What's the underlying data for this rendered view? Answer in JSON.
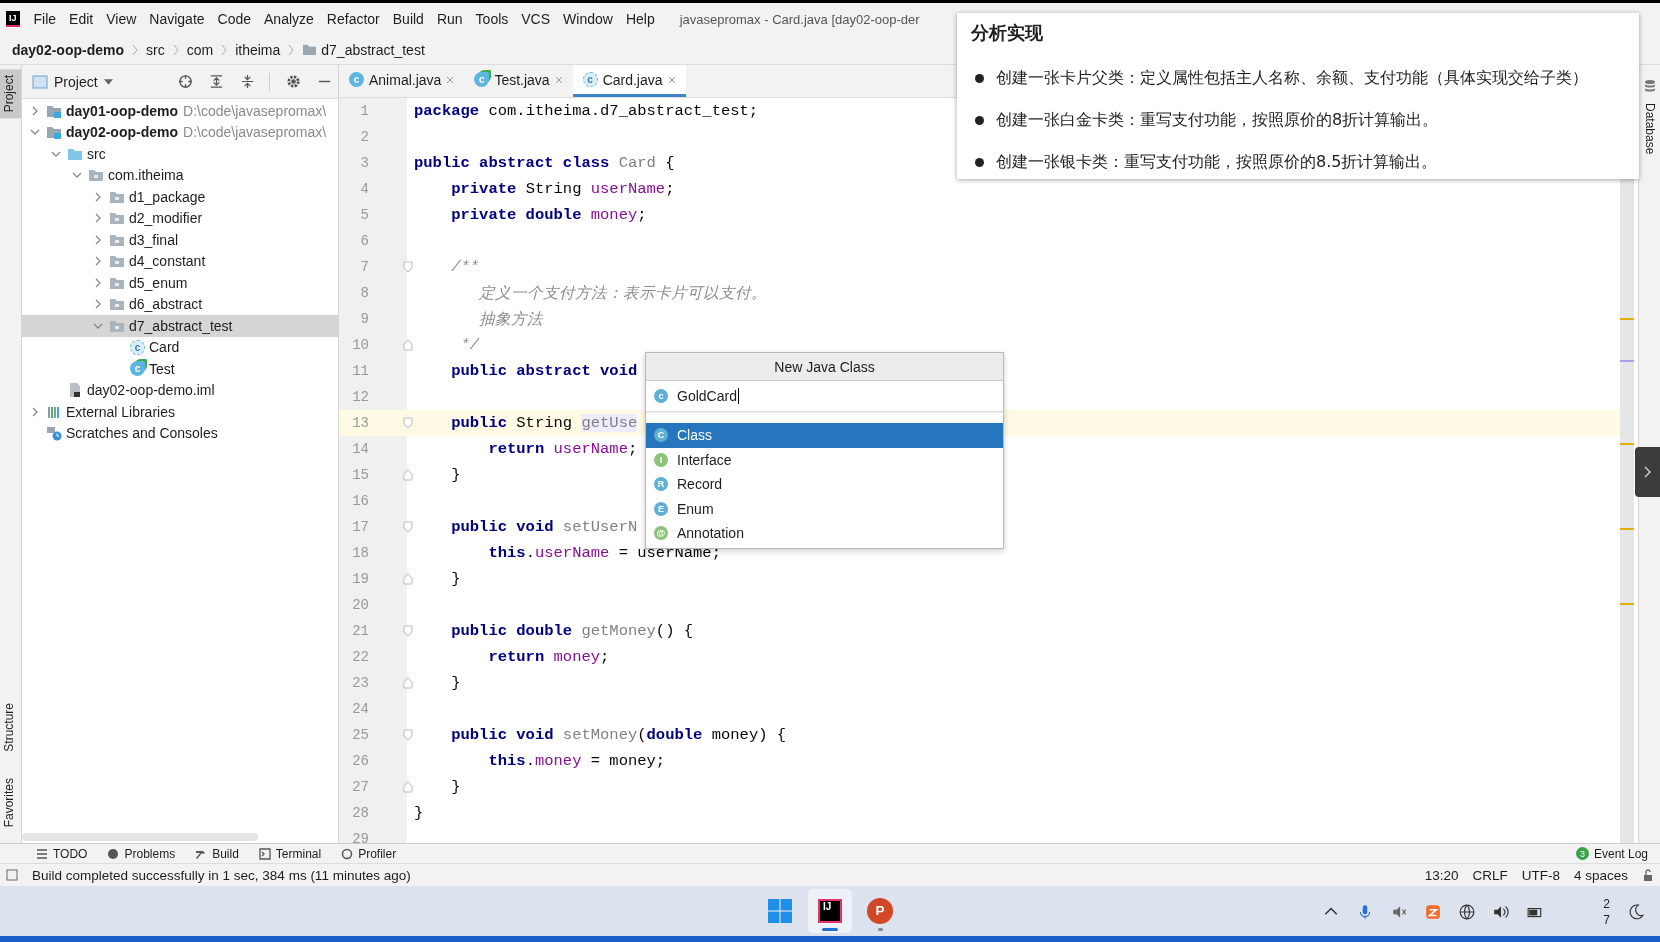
{
  "app_logo": "IJ",
  "menu": [
    "File",
    "Edit",
    "View",
    "Navigate",
    "Code",
    "Analyze",
    "Refactor",
    "Build",
    "Run",
    "Tools",
    "VCS",
    "Window",
    "Help"
  ],
  "window_title": "javasepromax - Card.java [day02-oop-der",
  "breadcrumbs": [
    {
      "label": "day02-oop-demo",
      "kind": "module"
    },
    {
      "label": "src",
      "kind": "dir"
    },
    {
      "label": "com",
      "kind": "dir"
    },
    {
      "label": "itheima",
      "kind": "dir"
    },
    {
      "label": "d7_abstract_test",
      "kind": "package"
    }
  ],
  "left_stripe": {
    "top": [
      {
        "label": "Project",
        "selected": true
      }
    ],
    "bottom": [
      {
        "label": "Structure",
        "selected": false
      },
      {
        "label": "Favorites",
        "selected": false
      }
    ]
  },
  "right_stripe": [
    {
      "label": "Database"
    }
  ],
  "project_panel": {
    "title": "Project",
    "tree": [
      {
        "label": "day01-oop-demo",
        "note": "D:\\code\\javasepromax\\",
        "kind": "module",
        "expanded": false,
        "selected": false
      },
      {
        "label": "day02-oop-demo",
        "note": "D:\\code\\javasepromax\\",
        "kind": "module",
        "expanded": true,
        "selected": false,
        "children": [
          {
            "label": "src",
            "kind": "source",
            "expanded": true,
            "selected": false,
            "children": [
              {
                "label": "com.itheima",
                "kind": "package",
                "expanded": true,
                "selected": false,
                "children": [
                  {
                    "label": "d1_package",
                    "kind": "package",
                    "expanded": false,
                    "selected": false
                  },
                  {
                    "label": "d2_modifier",
                    "kind": "package",
                    "expanded": false,
                    "selected": false
                  },
                  {
                    "label": "d3_final",
                    "kind": "package",
                    "expanded": false,
                    "selected": false
                  },
                  {
                    "label": "d4_constant",
                    "kind": "package",
                    "expanded": false,
                    "selected": false
                  },
                  {
                    "label": "d5_enum",
                    "kind": "package",
                    "expanded": false,
                    "selected": false
                  },
                  {
                    "label": "d6_abstract",
                    "kind": "package",
                    "expanded": false,
                    "selected": false
                  },
                  {
                    "label": "d7_abstract_test",
                    "kind": "package",
                    "expanded": true,
                    "selected": true,
                    "children": [
                      {
                        "label": "Card",
                        "kind": "abstract-class",
                        "icon_text": "c",
                        "selected": false
                      },
                      {
                        "label": "Test",
                        "kind": "runnable-class",
                        "icon_text": "c",
                        "selected": false
                      }
                    ]
                  }
                ]
              }
            ]
          },
          {
            "label": "day02-oop-demo.iml",
            "kind": "iml",
            "selected": false
          }
        ]
      },
      {
        "label": "External Libraries",
        "kind": "libraries",
        "expanded": false,
        "selected": false
      },
      {
        "label": "Scratches and Consoles",
        "kind": "scratches",
        "selected": false
      }
    ]
  },
  "tabs": [
    {
      "label": "Animal.java",
      "kind": "class",
      "icon_text": "c",
      "selected": false
    },
    {
      "label": "Test.java",
      "kind": "runnable",
      "icon_text": "c",
      "selected": false
    },
    {
      "label": "Card.java",
      "kind": "abstract",
      "icon_text": "c",
      "selected": true
    }
  ],
  "code": [
    {
      "n": "1",
      "kind": "plain",
      "caret": false,
      "tokens": [
        {
          "kind": "kw",
          "text": "package"
        },
        {
          "kind": "plain",
          "text": " com.itheima.d7_abstract_test;"
        }
      ]
    },
    {
      "n": "2",
      "kind": "plain",
      "caret": false
    },
    {
      "n": "3",
      "kind": "plain",
      "caret": false,
      "tokens": [
        {
          "kind": "kw",
          "text": "public abstract class "
        },
        {
          "kind": "unused",
          "text": "Card"
        },
        {
          "kind": "plain",
          "text": " {"
        }
      ]
    },
    {
      "n": "4",
      "kind": "plain",
      "caret": false,
      "tokens": [
        {
          "kind": "kw",
          "text": "    private"
        },
        {
          "kind": "plain",
          "text": " String "
        },
        {
          "kind": "field",
          "text": "userName"
        },
        {
          "kind": "plain",
          "text": ";"
        }
      ]
    },
    {
      "n": "5",
      "kind": "plain",
      "caret": false,
      "tokens": [
        {
          "kind": "kw",
          "text": "    private double "
        },
        {
          "kind": "field",
          "text": "money"
        },
        {
          "kind": "plain",
          "text": ";"
        }
      ]
    },
    {
      "n": "6",
      "kind": "plain",
      "caret": false
    },
    {
      "n": "7",
      "kind": "fold-start",
      "caret": false,
      "tokens": [
        {
          "kind": "comment",
          "text": "    /**"
        }
      ]
    },
    {
      "n": "8",
      "kind": "plain",
      "caret": false,
      "tokens": [
        {
          "kind": "comment",
          "text": "       定义一个支付方法：表示卡片可以支付。"
        }
      ]
    },
    {
      "n": "9",
      "kind": "plain",
      "caret": false,
      "tokens": [
        {
          "kind": "comment",
          "text": "       抽象方法"
        }
      ]
    },
    {
      "n": "10",
      "kind": "fold-end",
      "caret": false,
      "tokens": [
        {
          "kind": "comment",
          "text": "     */"
        }
      ]
    },
    {
      "n": "11",
      "kind": "plain",
      "caret": false,
      "tokens": [
        {
          "kind": "kw",
          "text": "    public abstract void"
        }
      ]
    },
    {
      "n": "12",
      "kind": "plain",
      "caret": false
    },
    {
      "n": "13",
      "kind": "fold-start",
      "caret": true,
      "tokens": [
        {
          "kind": "kw",
          "text": "    public"
        },
        {
          "kind": "plain",
          "text": " String "
        },
        {
          "kind": "usage",
          "text": "getUse"
        }
      ]
    },
    {
      "n": "14",
      "kind": "plain",
      "caret": false,
      "tokens": [
        {
          "kind": "kw",
          "text": "        return "
        },
        {
          "kind": "field",
          "text": "userName"
        },
        {
          "kind": "plain",
          "text": ";"
        }
      ]
    },
    {
      "n": "15",
      "kind": "fold-end",
      "caret": false,
      "tokens": [
        {
          "kind": "plain",
          "text": "    }"
        }
      ]
    },
    {
      "n": "16",
      "kind": "plain",
      "caret": false
    },
    {
      "n": "17",
      "kind": "fold-start",
      "caret": false,
      "tokens": [
        {
          "kind": "kw",
          "text": "    public void "
        },
        {
          "kind": "unused",
          "text": "setUserN"
        }
      ]
    },
    {
      "n": "18",
      "kind": "plain",
      "caret": false,
      "tokens": [
        {
          "kind": "kw",
          "text": "        this"
        },
        {
          "kind": "plain",
          "text": "."
        },
        {
          "kind": "field",
          "text": "userName"
        },
        {
          "kind": "plain",
          "text": " = userName;"
        }
      ]
    },
    {
      "n": "19",
      "kind": "fold-end",
      "caret": false,
      "tokens": [
        {
          "kind": "plain",
          "text": "    }"
        }
      ]
    },
    {
      "n": "20",
      "kind": "plain",
      "caret": false
    },
    {
      "n": "21",
      "kind": "fold-start",
      "caret": false,
      "tokens": [
        {
          "kind": "kw",
          "text": "    public double "
        },
        {
          "kind": "unused",
          "text": "getMoney"
        },
        {
          "kind": "plain",
          "text": "() {"
        }
      ]
    },
    {
      "n": "22",
      "kind": "plain",
      "caret": false,
      "tokens": [
        {
          "kind": "kw",
          "text": "        return "
        },
        {
          "kind": "field",
          "text": "money"
        },
        {
          "kind": "plain",
          "text": ";"
        }
      ]
    },
    {
      "n": "23",
      "kind": "fold-end",
      "caret": false,
      "tokens": [
        {
          "kind": "plain",
          "text": "    }"
        }
      ]
    },
    {
      "n": "24",
      "kind": "plain",
      "caret": false
    },
    {
      "n": "25",
      "kind": "fold-start",
      "caret": false,
      "tokens": [
        {
          "kind": "kw",
          "text": "    public void "
        },
        {
          "kind": "unused",
          "text": "setMoney"
        },
        {
          "kind": "plain",
          "text": "("
        },
        {
          "kind": "kw",
          "text": "double"
        },
        {
          "kind": "plain",
          "text": " money) {"
        }
      ]
    },
    {
      "n": "26",
      "kind": "plain",
      "caret": false,
      "tokens": [
        {
          "kind": "kw",
          "text": "        this"
        },
        {
          "kind": "plain",
          "text": "."
        },
        {
          "kind": "field",
          "text": "money"
        },
        {
          "kind": "plain",
          "text": " = money;"
        }
      ]
    },
    {
      "n": "27",
      "kind": "fold-end",
      "caret": false,
      "tokens": [
        {
          "kind": "plain",
          "text": "    }"
        }
      ]
    },
    {
      "n": "28",
      "kind": "plain",
      "caret": false,
      "tokens": [
        {
          "kind": "plain",
          "text": "}"
        }
      ]
    },
    {
      "n": "29",
      "kind": "plain",
      "caret": false
    }
  ],
  "new_class_popup": {
    "title": "New Java Class",
    "name_icon": "c",
    "name_value": "GoldCard",
    "options": [
      {
        "label": "Class",
        "letter": "C",
        "color": "#5fb0d6",
        "selected": true
      },
      {
        "label": "Interface",
        "letter": "I",
        "color": "#8cc47a",
        "selected": false
      },
      {
        "label": "Record",
        "letter": "R",
        "color": "#5fb0d6",
        "selected": false
      },
      {
        "label": "Enum",
        "letter": "E",
        "color": "#5fb0d6",
        "selected": false
      },
      {
        "label": "Annotation",
        "letter": "@",
        "color": "#8cc47a",
        "selected": false
      }
    ]
  },
  "note_popup": {
    "title": "分析实现",
    "bullets": [
      "创建一张卡片父类：定义属性包括主人名称、余额、支付功能（具体实现交给子类）",
      "创建一张白金卡类：重写支付功能，按照原价的8折计算输出。",
      "创建一张银卡类：重写支付功能，按照原价的8.5折计算输出。"
    ]
  },
  "bottom_tools": [
    {
      "label": "TODO",
      "kind": "list"
    },
    {
      "label": "Problems",
      "kind": "problems"
    },
    {
      "label": "Build",
      "kind": "hammer"
    },
    {
      "label": "Terminal",
      "kind": "terminal"
    },
    {
      "label": "Profiler",
      "kind": "profiler"
    }
  ],
  "event_log": {
    "label": "Event Log",
    "count": "3"
  },
  "status": {
    "message": "Build completed successfully in 1 sec, 384 ms (11 minutes ago)",
    "items": [
      "13:20",
      "CRLF",
      "UTF-8",
      "4 spaces"
    ]
  },
  "taskbar": {
    "apps": [
      {
        "kind": "windows",
        "selected": false
      },
      {
        "kind": "intellij",
        "text": "IJ",
        "selected": true
      },
      {
        "kind": "powerpoint",
        "text": "P",
        "selected": false
      }
    ],
    "clock": [
      "2",
      "7"
    ]
  }
}
